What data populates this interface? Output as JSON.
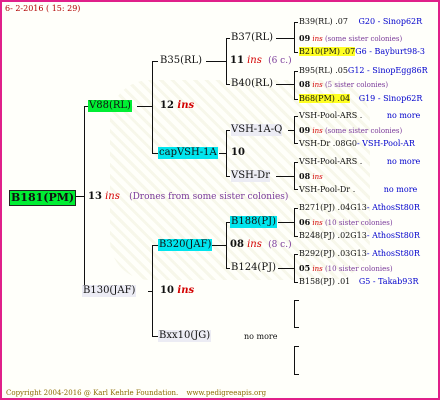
{
  "header": {
    "date": "6- 2-2016 ( 15: 29)"
  },
  "root": {
    "name": "B181(PM)"
  },
  "root_info": {
    "count": "13",
    "ins": "ins",
    "note": "(Drones from some sister colonies)"
  },
  "gen1": {
    "sire": {
      "name": "V88(RL)",
      "count": "12",
      "ins": "ins"
    },
    "dam": {
      "name": "B130(JAF)",
      "count": "10",
      "ins": "ins"
    }
  },
  "gen2": {
    "a": {
      "name": "B35(RL)",
      "count": "11",
      "ins": "ins",
      "sisters": "(6 c.)"
    },
    "b": {
      "name": "capVSH-1A",
      "count": "10"
    },
    "c": {
      "name": "B320(JAF)",
      "count": "08",
      "ins": "ins",
      "sisters": "(8 c.)"
    },
    "d": {
      "name": "Bxx10(JG)",
      "note": "no more"
    }
  },
  "gen3": {
    "a1": {
      "name": "B37(RL)"
    },
    "a2": {
      "name": "B40(RL)"
    },
    "b1": {
      "name": "VSH-1A-Q"
    },
    "b2": {
      "name": "VSH-Dr"
    },
    "c1": {
      "name": "B188(PJ)"
    },
    "c2": {
      "name": "B124(PJ)"
    }
  },
  "gen4": {
    "r1": {
      "left": "B39(RL)",
      "num": ".07",
      "right": "G20 - Sinop62R"
    },
    "r2": {
      "count": "09",
      "ins": "ins",
      "note": "(some sister colonies)"
    },
    "r3": {
      "left": "B210(PM)",
      "num": ".07",
      "right": "G6 - Bayburt98-3"
    },
    "r4": {
      "left": "B95(RL)",
      "num": ".05",
      "right": "G12 - SinopEgg86R"
    },
    "r5": {
      "count": "08",
      "ins": "ins",
      "note": "(5 sister colonies)"
    },
    "r6": {
      "left": "B68(PM)",
      "num": ".04",
      "right": "G19 - Sinop62R"
    },
    "r7": {
      "left": "VSH-Pool-ARS",
      "dots": ".",
      "right": "no more"
    },
    "r8": {
      "count": "09",
      "ins": "ins",
      "note": "(some sister colonies)"
    },
    "r9": {
      "left": "VSH-Dr",
      "num": ".08G0",
      "right": "- VSH-Pool-AR"
    },
    "r10": {
      "left": "VSH-Pool-ARS",
      "dots": ".",
      "right": "no more"
    },
    "r11": {
      "count": "08",
      "ins": "ins"
    },
    "r12": {
      "left": "VSH-Pool-Dr",
      "dots": ".",
      "right": "no more"
    },
    "r13": {
      "left": "B271(PJ)",
      "num": ".04G13",
      "right": "- AthosSt80R"
    },
    "r14": {
      "count": "06",
      "ins": "ins",
      "note": "(10 sister colonies)"
    },
    "r15": {
      "left": "B248(PJ)",
      "num": ".02G13",
      "right": "- AthosSt80R"
    },
    "r16": {
      "left": "B292(PJ)",
      "num": ".03G13",
      "right": "- AthosSt80R"
    },
    "r17": {
      "count": "05",
      "ins": "ins",
      "note": "(10 sister colonies)"
    },
    "r18": {
      "left": "B158(PJ)",
      "num": ".01",
      "right": "G5 - Takab93R"
    }
  },
  "footer": {
    "copyright": "Copyright 2004-2016 @ Karl Kehrle Foundation.",
    "url": "www.pedigreeapis.org"
  }
}
